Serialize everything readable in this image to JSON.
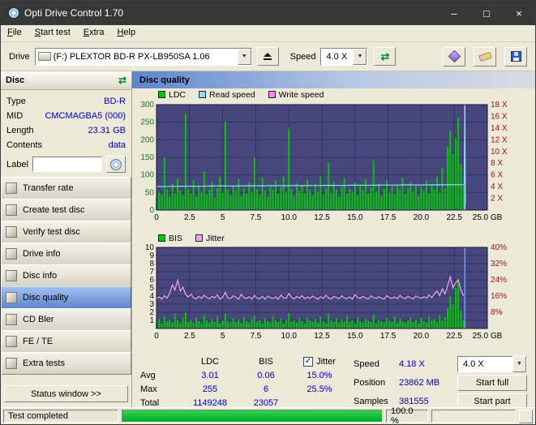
{
  "window": {
    "title": "Opti Drive Control 1.70"
  },
  "icons": {
    "minimize": "–",
    "maximize": "□",
    "close": "×",
    "dropdown": "▼",
    "refresh": "⇄",
    "check": "✓"
  },
  "menu": {
    "items": [
      "File",
      "Start test",
      "Extra",
      "Help"
    ]
  },
  "toolbar": {
    "drive_label": "Drive",
    "drive_value": "(F:) PLEXTOR BD-R PX-LB950SA 1.06",
    "speed_label": "Speed",
    "speed_value": "4.0 X"
  },
  "sidebar": {
    "header": "Disc",
    "info": [
      {
        "label": "Type",
        "value": "BD-R"
      },
      {
        "label": "MID",
        "value": "CMCMAGBA5 (000)"
      },
      {
        "label": "Length",
        "value": "23.31 GB"
      },
      {
        "label": "Contents",
        "value": "data"
      }
    ],
    "label_field": {
      "label": "Label",
      "value": ""
    },
    "buttons": [
      {
        "label": "Transfer rate",
        "active": false
      },
      {
        "label": "Create test disc",
        "active": false
      },
      {
        "label": "Verify test disc",
        "active": false
      },
      {
        "label": "Drive info",
        "active": false
      },
      {
        "label": "Disc info",
        "active": false
      },
      {
        "label": "Disc quality",
        "active": true
      },
      {
        "label": "CD Bler",
        "active": false
      },
      {
        "label": "FE / TE",
        "active": false
      },
      {
        "label": "Extra tests",
        "active": false
      }
    ],
    "status_window_button": "Status window >>"
  },
  "main": {
    "header": "Disc quality"
  },
  "stats": {
    "col_ldc": "LDC",
    "col_bis": "BIS",
    "jitter_label": "Jitter",
    "jitter_checked": true,
    "avg_label": "Avg",
    "avg_ldc": "3.01",
    "avg_bis": "0.06",
    "avg_jitter": "15.0%",
    "max_label": "Max",
    "max_ldc": "255",
    "max_bis": "6",
    "max_jitter": "25.5%",
    "total_label": "Total",
    "total_ldc": "1149248",
    "total_bis": "23057",
    "speed_label": "Speed",
    "speed_value": "4.18 X",
    "speed_select": "4.0 X",
    "position_label": "Position",
    "position_value": "23862 MB",
    "samples_label": "Samples",
    "samples_value": "381555",
    "start_full": "Start full",
    "start_part": "Start part"
  },
  "statusbar": {
    "text": "Test completed",
    "percent": "100.0 %",
    "progress_value": 100
  },
  "chart_data": [
    {
      "type": "bar",
      "title": "Disc quality - LDC / read speed",
      "legend": [
        {
          "label": "LDC",
          "color": "#00c800"
        },
        {
          "label": "Read speed",
          "color": "#8fd9ff"
        },
        {
          "label": "Write speed",
          "color": "#ff82ff"
        }
      ],
      "x_max": 25,
      "x_step_gb": 0.2,
      "x_ticks": [
        "0",
        "2.5",
        "5",
        "7.5",
        "10.0",
        "12.5",
        "15.0",
        "17.5",
        "20.0",
        "22.5",
        "25.0 GB"
      ],
      "y_left_ticks": [
        "300",
        "250",
        "200",
        "150",
        "100",
        "50",
        "0"
      ],
      "y_left_max": 300,
      "y_right_ticks": [
        "18 X",
        "16 X",
        "14 X",
        "12 X",
        "10 X",
        "8 X",
        "6 X",
        "4 X",
        "2 X"
      ],
      "y_right_max": 18,
      "plot_bg": "#47477e",
      "grid_color": "#32325e",
      "axis_left_color": "#0f7d0f",
      "axis_right_color": "#a11212",
      "bar_series": "LDC",
      "bar_color": "#00c800",
      "bars": [
        35,
        52,
        44,
        150,
        60,
        38,
        75,
        48,
        90,
        55,
        42,
        272,
        60,
        48,
        85,
        38,
        66,
        52,
        110,
        45,
        58,
        80,
        36,
        62,
        95,
        50,
        252,
        58,
        42,
        70,
        55,
        88,
        40,
        64,
        47,
        78,
        52,
        150,
        60,
        44,
        92,
        56,
        38,
        72,
        58,
        84,
        46,
        65,
        95,
        52,
        232,
        60,
        40,
        76,
        55,
        68,
        48,
        86,
        58,
        42,
        74,
        52,
        96,
        45,
        62,
        135,
        50,
        80,
        58,
        38,
        66,
        90,
        47,
        60,
        52,
        78,
        42,
        70,
        55,
        88,
        48,
        64,
        142,
        52,
        76,
        40,
        60,
        85,
        50,
        68,
        44,
        72,
        58,
        92,
        46,
        62,
        80,
        52,
        70,
        40,
        66,
        55,
        84,
        48,
        75,
        58,
        95,
        50,
        120,
        62,
        180,
        225,
        160,
        205,
        262,
        130,
        70
      ],
      "line_series": "Read speed",
      "line_color": "#8fd9ff",
      "line_points": [
        [
          0,
          4.02
        ],
        [
          1,
          4.05
        ],
        [
          2,
          4.07
        ],
        [
          3,
          4.06
        ],
        [
          4,
          4.1
        ],
        [
          5,
          4.12
        ],
        [
          6,
          4.1
        ],
        [
          7,
          4.15
        ],
        [
          8,
          4.14
        ],
        [
          9,
          4.17
        ],
        [
          10,
          4.16
        ],
        [
          11,
          4.2
        ],
        [
          12,
          4.18
        ],
        [
          13,
          4.22
        ],
        [
          14,
          4.2
        ],
        [
          15,
          4.25
        ],
        [
          16,
          4.23
        ],
        [
          17,
          4.27
        ],
        [
          18,
          4.26
        ],
        [
          19,
          4.3
        ],
        [
          20,
          4.28
        ],
        [
          21,
          4.32
        ],
        [
          22,
          4.3
        ],
        [
          23,
          4.34
        ],
        [
          23.25,
          4.35
        ],
        [
          23.3,
          17.8
        ],
        [
          23.34,
          1.0
        ]
      ],
      "end_marker_gb": 23.3,
      "end_marker_color": "#8fd9ff"
    },
    {
      "type": "bar",
      "title": "Disc quality - BIS / jitter",
      "legend": [
        {
          "label": "BIS",
          "color": "#00c800"
        },
        {
          "label": "Jitter",
          "color": "#efa6ef"
        }
      ],
      "x_max": 25,
      "x_step_gb": 0.2,
      "x_ticks": [
        "0",
        "2.5",
        "5",
        "7.5",
        "10.0",
        "12.5",
        "15.0",
        "17.5",
        "20.0",
        "22.5",
        "25.0 GB"
      ],
      "y_left_ticks": [
        "10",
        "9",
        "8",
        "7",
        "6",
        "5",
        "4",
        "3",
        "2",
        "1"
      ],
      "y_left_max": 10,
      "y_right_ticks": [
        "40%",
        "32%",
        "24%",
        "16%",
        "8%"
      ],
      "y_right_max": 40,
      "plot_bg": "#47477e",
      "grid_color": "#32325e",
      "axis_left_color": "#111111",
      "axis_right_color": "#a11212",
      "bar_series": "BIS",
      "bar_color": "#00c800",
      "bars": [
        0.8,
        1.2,
        0.6,
        1.5,
        0.9,
        1.1,
        0.7,
        1.8,
        1.0,
        0.6,
        1.3,
        2.0,
        0.8,
        1.1,
        0.7,
        1.4,
        0.9,
        0.6,
        1.6,
        1.0,
        0.7,
        1.2,
        0.8,
        1.5,
        0.6,
        1.0,
        1.8,
        0.9,
        0.7,
        1.3,
        0.8,
        1.1,
        0.6,
        1.4,
        0.9,
        0.7,
        1.2,
        1.6,
        0.8,
        1.0,
        0.6,
        1.3,
        0.9,
        0.7,
        1.5,
        1.0,
        0.8,
        1.2,
        0.6,
        1.1,
        1.9,
        0.8,
        1.0,
        0.7,
        1.3,
        0.9,
        0.6,
        1.4,
        1.0,
        0.8,
        1.2,
        0.7,
        1.5,
        0.9,
        0.6,
        1.8,
        1.0,
        0.8,
        1.3,
        0.7,
        1.1,
        0.9,
        1.6,
        0.8,
        1.0,
        0.6,
        1.4,
        0.9,
        0.7,
        1.2,
        1.0,
        0.8,
        1.7,
        0.6,
        1.1,
        0.9,
        0.7,
        1.3,
        1.0,
        0.8,
        1.5,
        0.6,
        1.2,
        0.9,
        0.7,
        1.0,
        1.4,
        0.8,
        1.1,
        0.6,
        1.3,
        0.9,
        0.7,
        1.5,
        1.0,
        1.2,
        0.8,
        1.6,
        1.0,
        1.4,
        2.5,
        4.0,
        3.0,
        5.0,
        6.0,
        2.2,
        1.0
      ],
      "line_series": "Jitter",
      "line_color": "#efa6ef",
      "line_values": [
        14.8,
        15.6,
        14.5,
        16.2,
        15.0,
        17.5,
        21.5,
        19.0,
        23.8,
        18.5,
        20.5,
        16.8,
        15.5,
        16.9,
        15.2,
        14.6,
        15.9,
        14.9,
        16.4,
        15.3,
        14.7,
        15.8,
        15.1,
        16.6,
        14.5,
        15.4,
        17.8,
        15.0,
        14.8,
        16.1,
        15.5,
        14.4,
        16.8,
        15.2,
        14.9,
        15.7,
        14.6,
        16.3,
        15.0,
        14.7,
        15.9,
        14.5,
        16.0,
        15.3,
        14.8,
        15.6,
        14.4,
        16.5,
        15.1,
        14.9,
        17.2,
        15.4,
        14.6,
        15.8,
        15.0,
        16.2,
        14.7,
        15.5,
        14.9,
        16.0,
        15.2,
        14.5,
        15.7,
        14.8,
        16.4,
        15.1,
        14.6,
        15.9,
        15.3,
        14.7,
        16.1,
        15.0,
        14.8,
        15.6,
        14.5,
        16.7,
        15.2,
        14.9,
        15.8,
        15.1,
        14.6,
        16.0,
        15.4,
        14.8,
        15.7,
        15.0,
        14.5,
        16.2,
        15.3,
        14.9,
        15.6,
        14.7,
        16.3,
        15.1,
        14.8,
        15.9,
        15.2,
        14.6,
        16.0,
        15.4,
        14.9,
        15.7,
        15.0,
        16.5,
        15.2,
        17.0,
        18.5,
        16.2,
        19.5,
        17.0,
        21.0,
        25.5,
        20.0,
        22.5,
        24.0,
        19.0,
        16.0
      ],
      "end_marker_gb": 23.3,
      "end_marker_color": "#5e9cff"
    }
  ]
}
